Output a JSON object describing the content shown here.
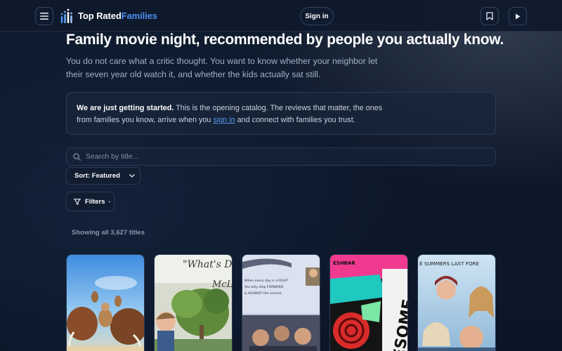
{
  "header": {
    "logo_text_a": "Top Rated",
    "logo_text_b": "Families",
    "signin_label": "Sign in"
  },
  "hero": {
    "title": "Family movie night, recommended by people you actually know.",
    "lead": "You do not care what a critic thought. You want to know whether your neighbor let their seven year old watch it, and whether the kids actually sat still."
  },
  "notice": {
    "bold": "We are just getting started.",
    "text_a": " This is the opening catalog. The reviews that matter, the ones from families you know, arrive when you ",
    "link": "sign in",
    "text_b": " and connect with families you trust."
  },
  "search": {
    "placeholder": "Search by title..."
  },
  "sort": {
    "label": "Sort: Featured"
  },
  "filters": {
    "label": "Filters",
    "indicator": "•"
  },
  "results": {
    "count_text": "Showing all 3,627 titles"
  },
  "posters": [
    {
      "text": ""
    },
    {
      "text": "\"What's D",
      "text2": "McL"
    },
    {
      "line1": "When every day is a FIGHT",
      "line2": "You only step FORWARD",
      "line3": "& AGAINST the current."
    },
    {
      "text": "ESOME",
      "top": "ESHBAR"
    },
    {
      "text": "E SUMMERS LAST FORE"
    }
  ],
  "colors": {
    "accent": "#4c8ff0",
    "link": "#5a9af1",
    "background": "#0c1728"
  }
}
